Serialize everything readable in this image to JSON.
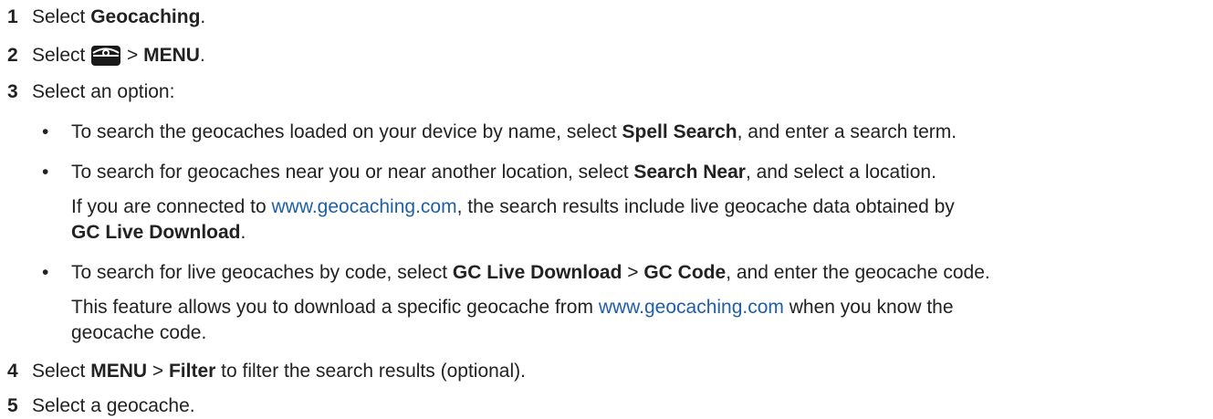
{
  "steps": [
    {
      "num": "1",
      "pre": "Select ",
      "bold": "Geocaching",
      "post": "."
    },
    {
      "num": "2",
      "pre": "Select ",
      "sep": " > ",
      "bold": "MENU",
      "post": ".",
      "icon": "geocache-chest-icon"
    },
    {
      "num": "3",
      "text": "Select an option:"
    },
    {
      "num": "4",
      "pre": "Select ",
      "bold1": "MENU",
      "sep": " > ",
      "bold2": "Filter",
      "post": " to filter the search results (optional)."
    },
    {
      "num": "5",
      "text": "Select a geocache."
    }
  ],
  "bullets": [
    {
      "dot": "•",
      "pre": "To search the geocaches loaded on your device by name, select ",
      "bold": "Spell Search",
      "post": ", and enter a search term."
    },
    {
      "dot": "•",
      "pre": "To search for geocaches near you or near another location, select ",
      "bold": "Search Near",
      "post": ", and select a location.",
      "note_pre": "If you are connected to ",
      "note_link": "www.geocaching.com",
      "note_post": ", the search results include live geocache data obtained by",
      "note2_bold": "GC Live Download",
      "note2_post": "."
    },
    {
      "dot": "•",
      "pre": "To search for live geocaches by code, select ",
      "bold1": "GC Live Download",
      "sep": " > ",
      "bold2": "GC Code",
      "post": ", and enter the geocache code.",
      "note_pre": "This feature allows you to download a specific geocache from ",
      "note_link": "www.geocaching.com",
      "note_post": " when you know the",
      "note2_text": "geocache code."
    }
  ],
  "colors": {
    "text": "#222222",
    "link": "#1f5fa8"
  }
}
